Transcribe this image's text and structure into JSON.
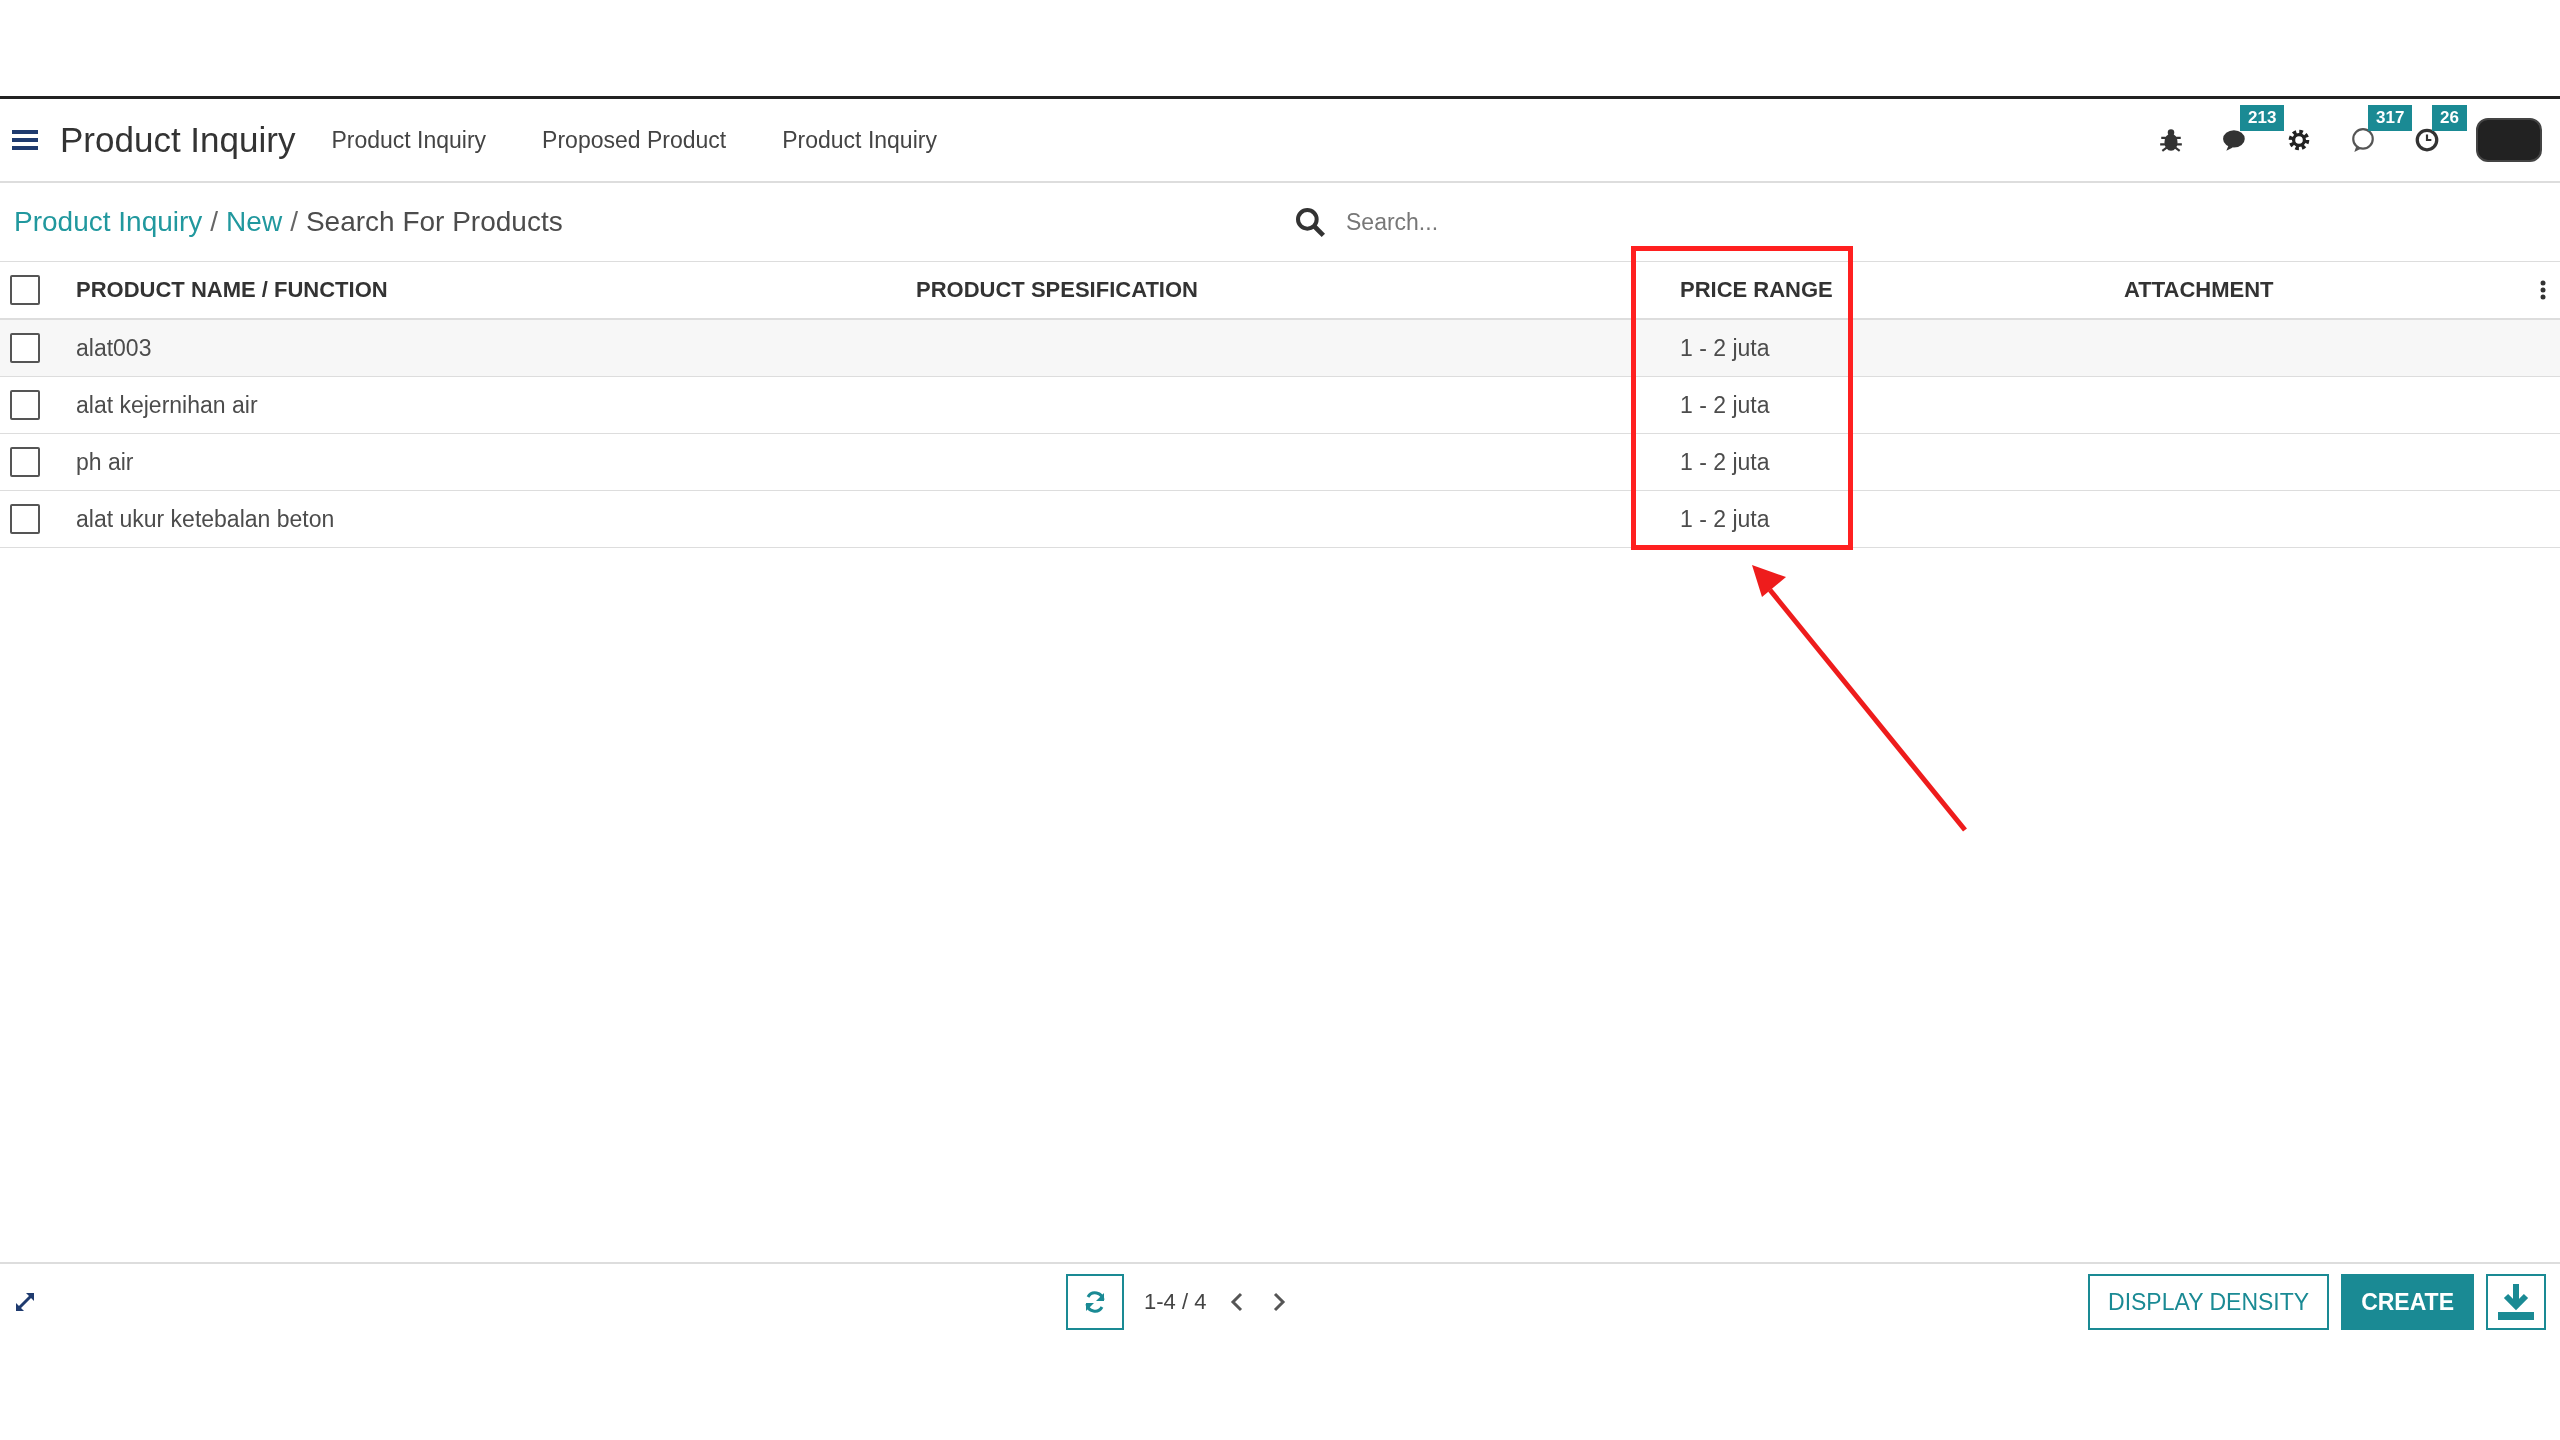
{
  "navbar": {
    "app_title": "Product Inquiry",
    "menu": [
      "Product Inquiry",
      "Proposed Product",
      "Product Inquiry"
    ],
    "systray": [
      {
        "kind": "bug"
      },
      {
        "kind": "chat",
        "badge": "213"
      },
      {
        "kind": "gear"
      },
      {
        "kind": "whatsapp",
        "badge": "317"
      },
      {
        "kind": "clock",
        "badge": "26"
      },
      {
        "kind": "avatar"
      }
    ]
  },
  "breadcrumb_separator": "/",
  "breadcrumb": [
    {
      "label": "Product Inquiry",
      "link": true
    },
    {
      "label": "New",
      "link": true
    },
    {
      "label": "Search For Products",
      "link": false
    }
  ],
  "search": {
    "placeholder": "Search..."
  },
  "table": {
    "columns": [
      "PRODUCT NAME / FUNCTION",
      "PRODUCT SPESIFICATION",
      "PRICE RANGE",
      "ATTACHMENT"
    ],
    "all_checked": false,
    "rows": [
      {
        "checked": false,
        "cells": [
          "alat003",
          "",
          "1 - 2 juta",
          ""
        ]
      },
      {
        "checked": false,
        "cells": [
          "alat kejernihan air",
          "",
          "1 - 2 juta",
          ""
        ]
      },
      {
        "checked": false,
        "cells": [
          "ph air",
          "",
          "1 - 2 juta",
          ""
        ]
      },
      {
        "checked": false,
        "cells": [
          "alat ukur ketebalan beton",
          "",
          "1 - 2 juta",
          ""
        ]
      }
    ]
  },
  "footer": {
    "pager": "1-4 / 4",
    "buttons": [
      {
        "label": "DISPLAY DENSITY",
        "kind": "secondary"
      },
      {
        "label": "CREATE",
        "kind": "primary"
      }
    ]
  }
}
